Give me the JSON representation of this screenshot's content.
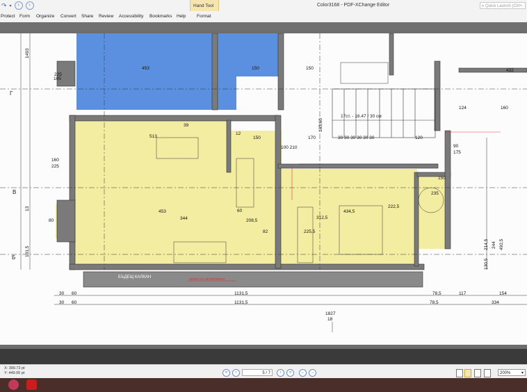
{
  "window": {
    "title": "Color3168 - PDF-XChange Editor",
    "context_tab_group": "Hand Tool",
    "quick_launch_placeholder": "Quick Launch (Ctrl+."
  },
  "menu": {
    "items": [
      "Protect",
      "Form",
      "Organize",
      "Convert",
      "Share",
      "Review",
      "Accessibility",
      "Bookmarks",
      "Help",
      "Format"
    ]
  },
  "drawing": {
    "labels": {
      "grid_g": "Г",
      "grid_v": "В",
      "grid_b": "Б",
      "stairs": "17ст. - 16.47 / 30 см",
      "fire_wall": "БЪДЕЩ КАЛКАН",
      "limit_note": "линия на застрояване"
    },
    "dims": {
      "d453_top": "453",
      "d150_top": "150",
      "d150_top2": "150",
      "d432": "432",
      "d160": "160",
      "d124": "124",
      "d513": "513",
      "d39": "39",
      "d12": "12",
      "d150_mid": "150",
      "d100_210": "100 210",
      "d170": "170",
      "d30s": "30 30 30 30 30 30",
      "d120": "120",
      "d90": "90",
      "d175": "175",
      "d453_mid": "453",
      "d344": "344",
      "d82": "82",
      "d60": "60",
      "d2085": "208,5",
      "d2255": "225,5",
      "d4345": "434,5",
      "d3125": "312,5",
      "d2225": "222,5",
      "d150_r": "150",
      "d235": "235",
      "d225": "225",
      "d80": "80",
      "d160_l": "160",
      "d225_l": "225",
      "d105": "105",
      "d1315_l": "131,5",
      "d1315_r": "1131,5",
      "d1315_r2": "1131,5",
      "d785": "78,5",
      "d785_2": "78,5",
      "d117": "117",
      "d154": "154",
      "d334": "334",
      "d1827": "1827",
      "d18": "18",
      "d30_l1": "30",
      "d60_l1": "60",
      "d30_l2": "30",
      "d60_l2": "60",
      "d4925": "492,5",
      "d244": "244",
      "d2145": "214,5",
      "d13": "13",
      "d1493": "1493",
      "d163": "163,60",
      "d1305": "130,5"
    }
  },
  "status": {
    "x_coord": "X: 390.72 pt",
    "y_coord": "Y: 449.06 pt",
    "page_indicator": "5 / 7",
    "zoom": "200%"
  }
}
